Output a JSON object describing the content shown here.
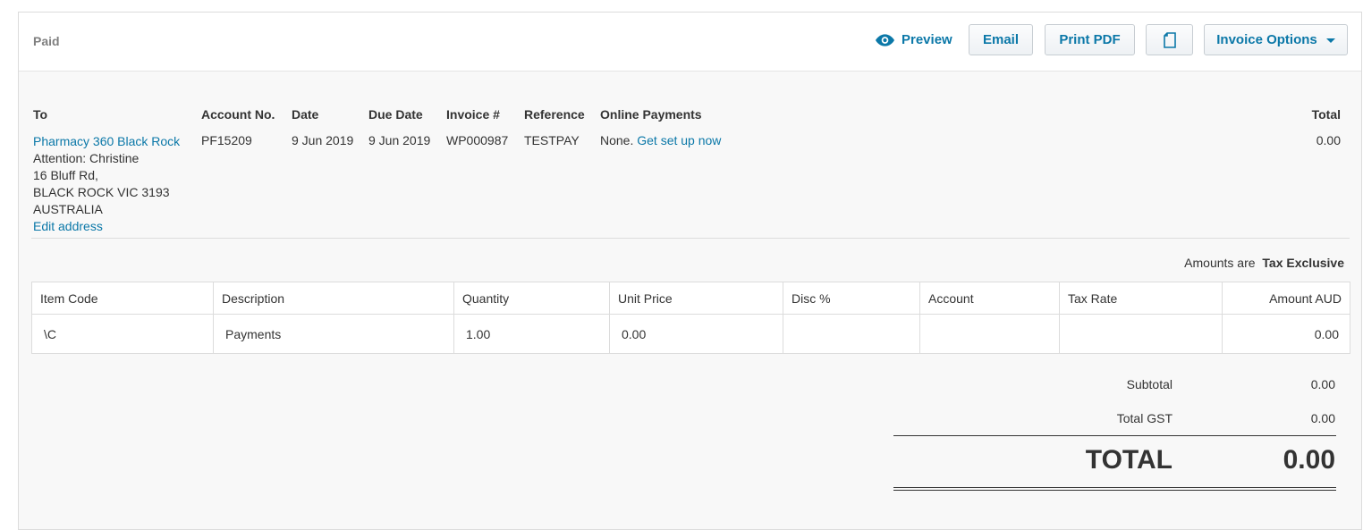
{
  "topbar": {
    "status": "Paid",
    "preview_label": "Preview",
    "email_label": "Email",
    "print_pdf_label": "Print PDF",
    "invoice_options_label": "Invoice Options"
  },
  "header": {
    "to_label": "To",
    "account_no_label": "Account No.",
    "date_label": "Date",
    "due_date_label": "Due Date",
    "invoice_no_label": "Invoice #",
    "reference_label": "Reference",
    "online_payments_label": "Online Payments",
    "total_label": "Total",
    "contact_name": "Pharmacy 360 Black Rock",
    "address_lines": [
      "Attention: Christine",
      "16 Bluff Rd,",
      "BLACK ROCK VIC 3193",
      "AUSTRALIA"
    ],
    "edit_address_label": "Edit address",
    "account_no": "PF15209",
    "date": "9 Jun 2019",
    "due_date": "9 Jun 2019",
    "invoice_no": "WP000987",
    "reference": "TESTPAY",
    "online_payments_status": "None.",
    "online_payments_link": "Get set up now",
    "total": "0.00"
  },
  "tax_note": {
    "prefix": "Amounts are",
    "mode": "Tax Exclusive"
  },
  "line_items": {
    "columns": [
      "Item Code",
      "Description",
      "Quantity",
      "Unit Price",
      "Disc %",
      "Account",
      "Tax Rate",
      "Amount AUD"
    ],
    "rows": [
      [
        "\\C",
        "Payments",
        "1.00",
        "0.00",
        "",
        "",
        "",
        "0.00"
      ]
    ]
  },
  "totals": {
    "subtotal_label": "Subtotal",
    "subtotal": "0.00",
    "gst_label": "Total GST",
    "gst": "0.00",
    "total_label": "TOTAL",
    "total": "0.00"
  },
  "colors": {
    "accent": "#0b78a8",
    "text": "#333333",
    "muted": "#808080",
    "panel_bg": "#f8f8f8",
    "border": "#dcdcdc"
  }
}
